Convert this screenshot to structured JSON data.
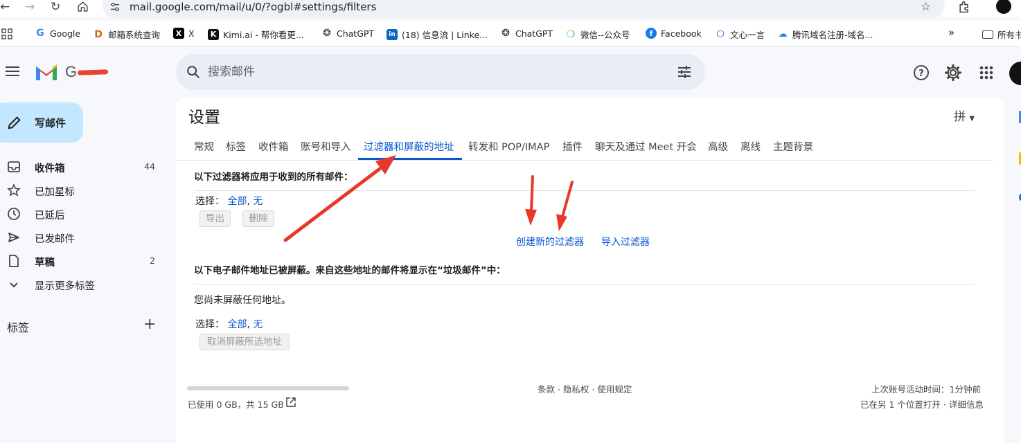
{
  "browser": {
    "url": "mail.google.com/mail/u/0/?ogbl#settings/filters",
    "bookmarks": [
      {
        "label": "Google",
        "icon": "google-icon"
      },
      {
        "label": "邮箱系统查询",
        "icon": "d-icon"
      },
      {
        "label": "X",
        "icon": "x-icon"
      },
      {
        "label": "Kimi.ai - 帮你看更...",
        "icon": "kimi-icon"
      },
      {
        "label": "ChatGPT",
        "icon": "chatgpt-icon"
      },
      {
        "label": "(18) 信息流 | Linke...",
        "icon": "linkedin-icon"
      },
      {
        "label": "ChatGPT",
        "icon": "chatgpt-icon"
      },
      {
        "label": "微信--公众号",
        "icon": "wechat-icon"
      },
      {
        "label": "Facebook",
        "icon": "facebook-icon"
      },
      {
        "label": "文心一言",
        "icon": "wenxin-icon"
      },
      {
        "label": "腾讯域名注册-域名...",
        "icon": "tencent-cloud-icon"
      }
    ],
    "more": "»",
    "all_bookmarks": "所有书"
  },
  "header": {
    "logo_g": "G",
    "search_placeholder": "搜索邮件"
  },
  "sidebar": {
    "compose": "写邮件",
    "items": [
      {
        "label": "收件箱",
        "count": "44",
        "icon": "inbox-icon",
        "bold": true
      },
      {
        "label": "已加星标",
        "count": "",
        "icon": "star-icon",
        "bold": false
      },
      {
        "label": "已延后",
        "count": "",
        "icon": "clock-icon",
        "bold": false
      },
      {
        "label": "已发邮件",
        "count": "",
        "icon": "send-icon",
        "bold": false
      },
      {
        "label": "草稿",
        "count": "2",
        "icon": "draft-icon",
        "bold": true
      },
      {
        "label": "显示更多标签",
        "count": "",
        "icon": "chevron-down-icon",
        "bold": false
      }
    ],
    "labels_heading": "标签",
    "labels_add": "+"
  },
  "settings": {
    "title": "设置",
    "ime": "拼",
    "tabs": [
      "常规",
      "标签",
      "收件箱",
      "账号和导入",
      "过滤器和屏蔽的地址",
      "转发和 POP/IMAP",
      "插件",
      "聊天及通过 Meet 开会",
      "高级",
      "离线",
      "主题背景"
    ],
    "active_tab": "过滤器和屏蔽的地址",
    "filters": {
      "heading": "以下过滤器将应用于收到的所有邮件：",
      "select_label": "选择：",
      "select_all": "全部",
      "select_none": "无",
      "sep": ",",
      "export_btn": "导出",
      "delete_btn": "删除",
      "create_link": "创建新的过滤器",
      "import_link": "导入过滤器"
    },
    "blocked": {
      "heading": "以下电子邮件地址已被屏蔽。来自这些地址的邮件将显示在“垃圾邮件”中：",
      "empty_text": "您尚未屏蔽任何地址。",
      "select_label": "选择：",
      "select_all": "全部",
      "select_none": "无",
      "sep": ",",
      "unblock_btn": "取消屏蔽所选地址"
    }
  },
  "footer": {
    "storage": "已使用 0 GB，共 15 GB",
    "policies": "条款 · 隐私权 · 使用规定",
    "last_activity": "上次账号活动时间：1分钟前",
    "open_elsewhere": "已在另 1 个位置打开 · 详细信息"
  },
  "colors": {
    "accent": "#0b57d0",
    "compose_bg": "#c2e7ff",
    "annotation_arrow": "#e8382a"
  }
}
